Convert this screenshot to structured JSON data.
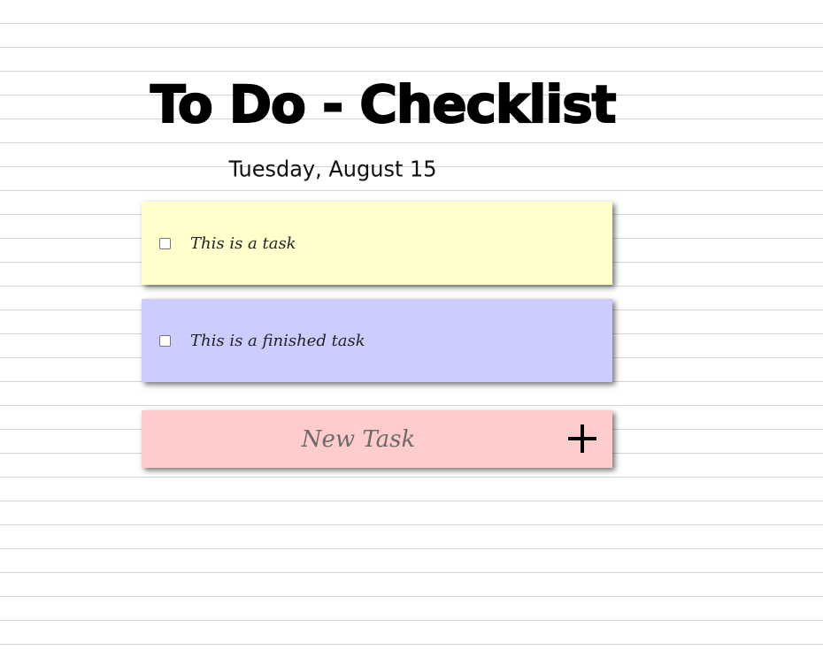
{
  "header": {
    "title": "To Do - Checklist",
    "date": "Tuesday, August 15"
  },
  "tasks": [
    {
      "text": "This is a task",
      "checked": false,
      "color": "#ffffcc"
    },
    {
      "text": "This is a finished task",
      "checked": false,
      "color": "#ccccff"
    }
  ],
  "new_task": {
    "placeholder": "New Task",
    "color": "#ffcccc",
    "add_icon": "plus-icon"
  },
  "colors": {
    "background": "#ffffff",
    "rule_line": "#d3d3d3"
  }
}
